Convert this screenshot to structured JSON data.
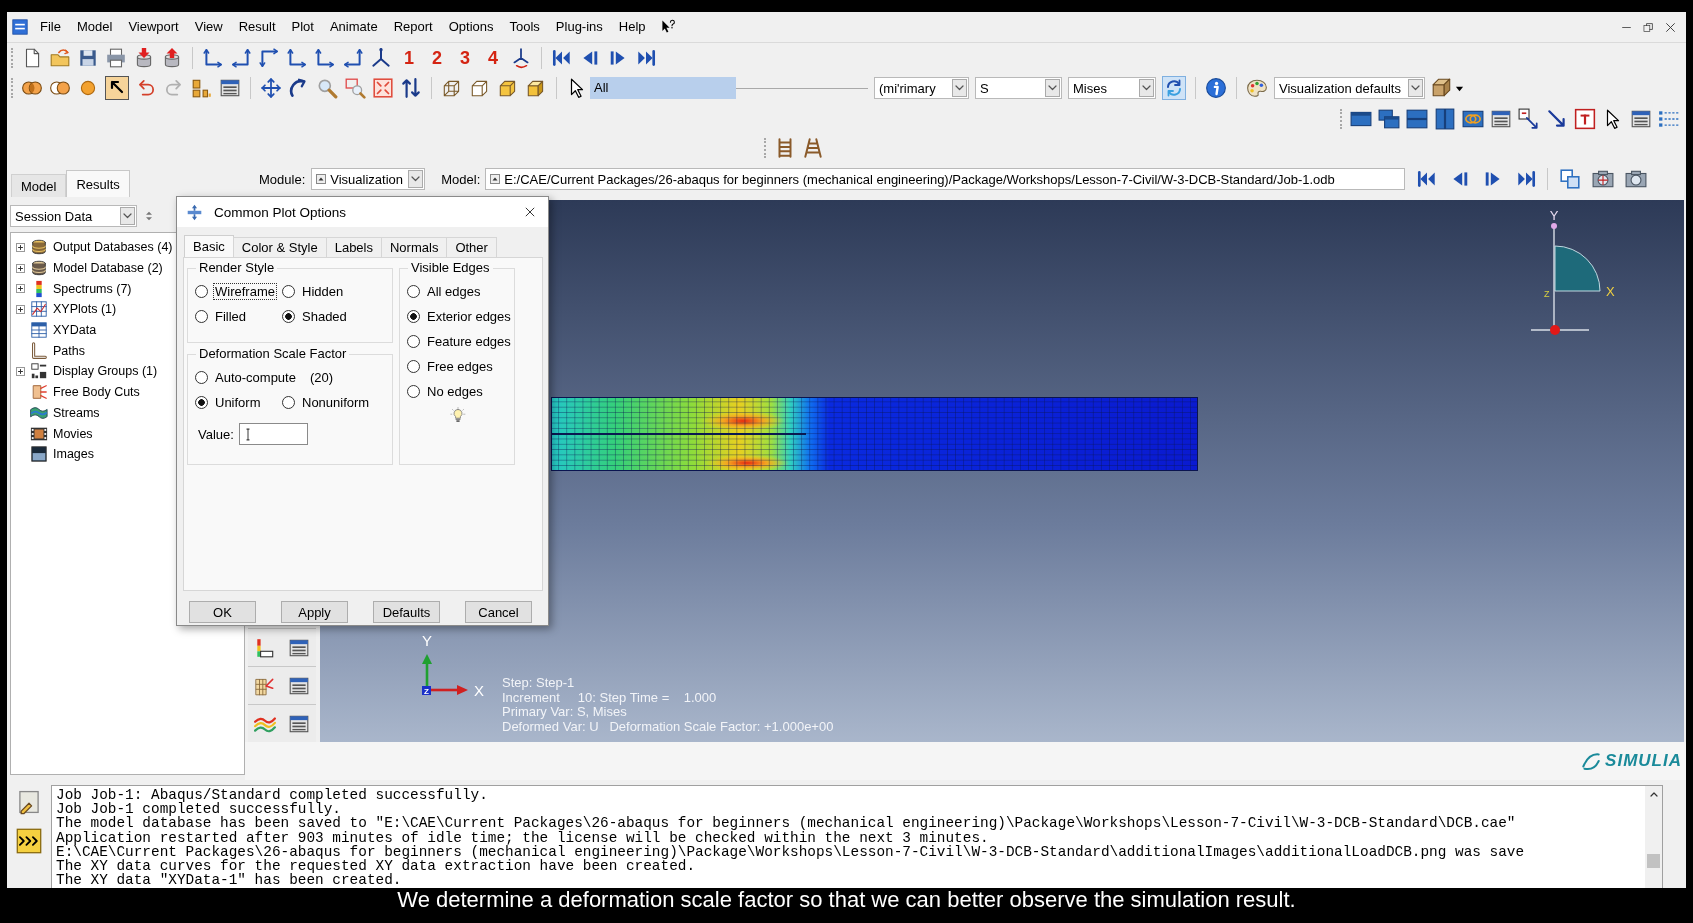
{
  "menu_bar": {
    "items": [
      "File",
      "Model",
      "Viewport",
      "View",
      "Result",
      "Plot",
      "Animate",
      "Report",
      "Options",
      "Tools",
      "Plug-ins",
      "Help"
    ]
  },
  "toolbar": {
    "view_presets": [
      "1",
      "2",
      "3",
      "4"
    ],
    "pick_active": true,
    "selection": "All",
    "step": "(mi'rimary",
    "variable": "S",
    "invariant": "Mises",
    "sync_active": true,
    "style": "Visualization defaults"
  },
  "context_bar": {
    "module_label": "Module:",
    "module": "Visualization",
    "model_label": "Model:",
    "model": "E:/CAE/Current Packages/26-abaqus for beginners (mechanical engineering)/Package/Workshops/Lesson-7-Civil/W-3-DCB-Standard/Job-1.odb"
  },
  "model_tree": {
    "tabs": [
      {
        "label": "Model",
        "selected": false
      },
      {
        "label": "Results",
        "selected": true
      }
    ],
    "source": "Session Data",
    "items": [
      {
        "label": "Output Databases (4)",
        "expandable": true
      },
      {
        "label": "Model Database (2)",
        "expandable": true
      },
      {
        "label": "Spectrums (7)",
        "expandable": true
      },
      {
        "label": "XYPlots (1)",
        "expandable": true
      },
      {
        "label": "XYData",
        "expandable": false
      },
      {
        "label": "Paths",
        "expandable": false
      },
      {
        "label": "Display Groups (1)",
        "expandable": true
      },
      {
        "label": "Free Body Cuts",
        "expandable": false
      },
      {
        "label": "Streams",
        "expandable": false
      },
      {
        "label": "Movies",
        "expandable": false
      },
      {
        "label": "Images",
        "expandable": false
      }
    ]
  },
  "dialog": {
    "title": "Common Plot Options",
    "tabs": [
      {
        "label": "Basic",
        "selected": true
      },
      {
        "label": "Color & Style",
        "selected": false
      },
      {
        "label": "Labels",
        "selected": false
      },
      {
        "label": "Normals",
        "selected": false
      },
      {
        "label": "Other",
        "selected": false
      }
    ],
    "render_style": {
      "title": "Render Style",
      "options": [
        {
          "label": "Wireframe",
          "selected": false,
          "focused": true
        },
        {
          "label": "Hidden",
          "selected": false,
          "focused": false
        },
        {
          "label": "Filled",
          "selected": false,
          "focused": false
        },
        {
          "label": "Shaded",
          "selected": true,
          "focused": false
        }
      ]
    },
    "scale_factor": {
      "title": "Deformation Scale Factor",
      "options": [
        {
          "label": "Auto-compute",
          "selected": false,
          "note": "(20)"
        },
        {
          "label": "Uniform",
          "selected": true
        },
        {
          "label": "Nonuniform",
          "selected": false
        }
      ],
      "value_label": "Value:"
    },
    "visible_edges": {
      "title": "Visible Edges",
      "options": [
        {
          "label": "All edges",
          "selected": false
        },
        {
          "label": "Exterior edges",
          "selected": true
        },
        {
          "label": "Feature edges",
          "selected": false
        },
        {
          "label": "Free edges",
          "selected": false
        },
        {
          "label": "No edges",
          "selected": false
        }
      ]
    },
    "buttons": [
      "OK",
      "Apply",
      "Defaults",
      "Cancel"
    ]
  },
  "viewport": {
    "triad": {
      "y": "Y",
      "x": "X",
      "z": "Z"
    },
    "axes": {
      "y": "Y",
      "x": "X",
      "z": "Z"
    },
    "state_block": [
      "Step: Step-1",
      "Increment     10: Step Time =    1.000",
      "Primary Var: S, Mises",
      "Deformed Var: U   Deformation Scale Factor: +1.000e+00"
    ]
  },
  "brand": "SIMULIA",
  "message_area": {
    "lines": [
      "Job Job-1: Abaqus/Standard completed successfully.",
      "Job Job-1 completed successfully.",
      "The model database has been saved to \"E:\\CAE\\Current Packages\\26-abaqus for beginners (mechanical engineering)\\Package\\Workshops\\Lesson-7-Civil\\W-3-DCB-Standard\\DCB.cae\"",
      "Application restarted after 903 minutes of idle time; the license will be checked within the next 3 minutes.",
      "E:\\CAE\\Current Packages\\26-abaqus for beginners (mechanical engineering)\\Package\\Workshops\\Lesson-7-Civil\\W-3-DCB-Standard\\additionalImages\\additionalLoadDCB.png was save",
      "The XY data curves for the requested XY data extraction have been created.",
      "The XY data \"XYData-1\" has been created."
    ]
  },
  "caption": "We determine a deformation scale factor so that we can better observe the simulation result."
}
